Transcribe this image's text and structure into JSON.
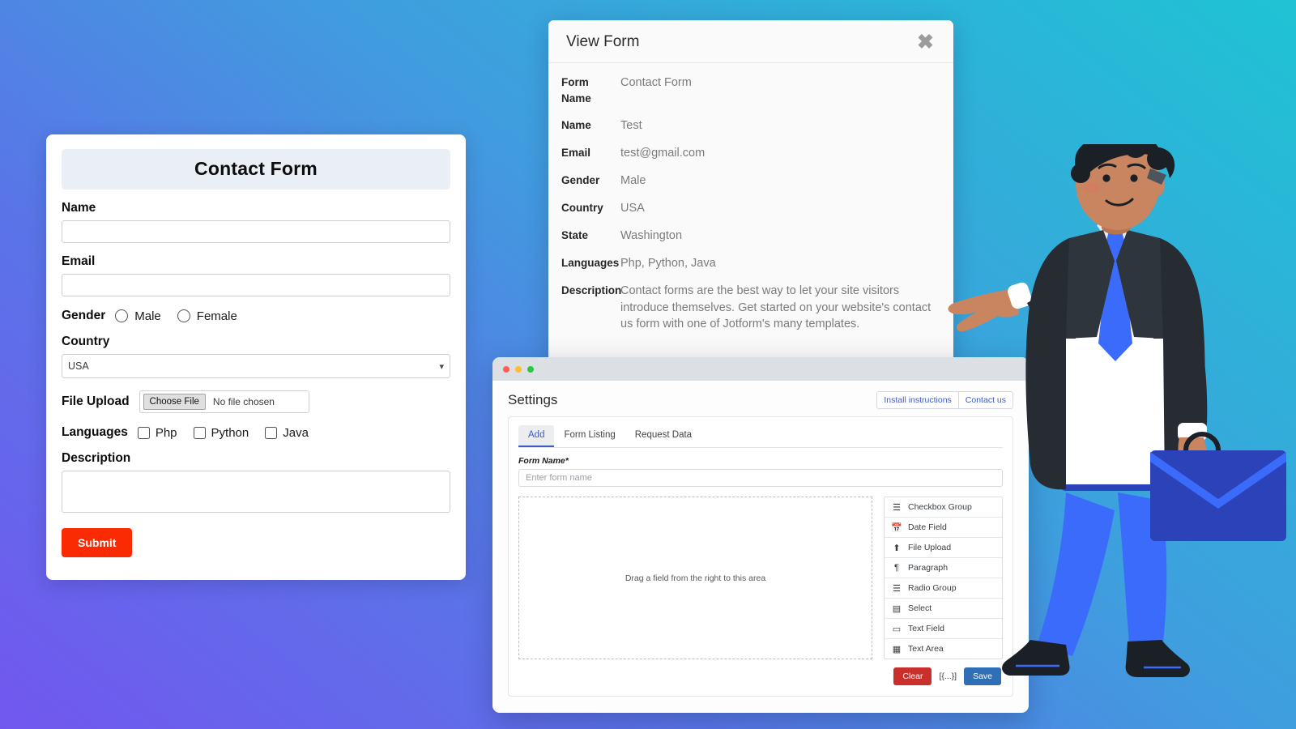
{
  "background": {
    "gradient_from": "#7257ef",
    "gradient_mid": "#3f9ede",
    "gradient_to": "#1fc3d4"
  },
  "contact_form": {
    "title": "Contact Form",
    "name_label": "Name",
    "name_value": "",
    "email_label": "Email",
    "email_value": "",
    "gender_label": "Gender",
    "gender_options": [
      "Male",
      "Female"
    ],
    "country_label": "Country",
    "country_selected": "USA",
    "country_options": [
      "USA"
    ],
    "file_label": "File Upload",
    "file_button": "Choose File",
    "file_status": "No file chosen",
    "languages_label": "Languages",
    "language_options": [
      "Php",
      "Python",
      "Java"
    ],
    "description_label": "Description",
    "description_value": "",
    "submit_label": "Submit",
    "submit_color": "#fa2a02"
  },
  "view_modal": {
    "title": "View Form",
    "close_glyph": "✖",
    "rows": [
      {
        "label": "Form Name",
        "value": "Contact Form"
      },
      {
        "label": "Name",
        "value": "Test"
      },
      {
        "label": "Email",
        "value": "test@gmail.com"
      },
      {
        "label": "Gender",
        "value": "Male"
      },
      {
        "label": "Country",
        "value": "USA"
      },
      {
        "label": "State",
        "value": "Washington"
      },
      {
        "label": "Languages",
        "value": "Php, Python, Java"
      },
      {
        "label": "Description",
        "value": "Contact forms are the best way to let your site visitors introduce themselves. Get started on your website's contact us form with one of Jotform's many templates."
      }
    ]
  },
  "settings_window": {
    "title": "Settings",
    "header_links": [
      "Install instructions",
      "Contact us"
    ],
    "tabs": [
      {
        "label": "Add",
        "active": true
      },
      {
        "label": "Form Listing",
        "active": false
      },
      {
        "label": "Request Data",
        "active": false
      }
    ],
    "form_name_label": "Form Name*",
    "form_name_placeholder": "Enter form name",
    "form_name_value": "",
    "dropzone_text": "Drag a field from the right to this area",
    "palette_items": [
      {
        "icon": "list-icon",
        "glyph": "≣",
        "label": "Checkbox Group"
      },
      {
        "icon": "calendar-icon",
        "glyph": "Ὄ5",
        "label": "Date Field"
      },
      {
        "icon": "upload-icon",
        "glyph": "⬆",
        "label": "File Upload"
      },
      {
        "icon": "paragraph-icon",
        "glyph": "¶",
        "label": "Paragraph"
      },
      {
        "icon": "list-icon",
        "glyph": "≣",
        "label": "Radio Group"
      },
      {
        "icon": "select-icon",
        "glyph": "▤",
        "label": "Select"
      },
      {
        "icon": "textfield-icon",
        "glyph": "▭",
        "label": "Text Field"
      },
      {
        "icon": "textarea-icon",
        "glyph": "▦",
        "label": "Text Area"
      }
    ],
    "buttons": {
      "clear": "Clear",
      "clear_color": "#c9302c",
      "json": "[{...}]",
      "save": "Save",
      "save_color": "#2f6fb5"
    }
  },
  "illustration": {
    "name": "businessman-with-briefcase",
    "suit_color": "#272c33",
    "pants_color": "#3b6bfb",
    "tie_color": "#3b6bfb",
    "briefcase_color": "#2c42b8",
    "skin_color": "#c98560"
  }
}
